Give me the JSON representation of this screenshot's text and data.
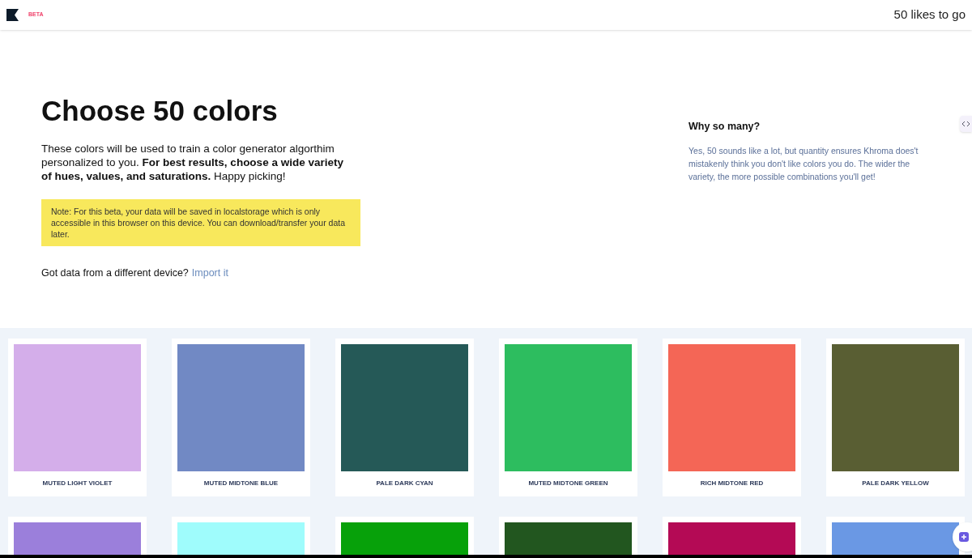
{
  "header": {
    "badge": "BETA",
    "progress": "50 likes to go"
  },
  "intro": {
    "title": "Choose 50 colors",
    "text": "These colors will be used to train a color generator algorthim personalized to you. **For best results, choose a wide variety of hues, values, and saturations.** Happy picking!",
    "note": "Note: For this beta, your data will be saved in localstorage which is only accessible in this browser on this device. You can download/transfer your data later.",
    "import_prompt": "Got data from a different device?",
    "import_link": "Import it"
  },
  "aside": {
    "title": "Why so many?",
    "text": "Yes, 50 sounds like a lot, but quantity ensures Khroma does't mistakenly think you don't like colors you do. The wider the variety, the more possible combinations you'll get!"
  },
  "swatches": [
    {
      "name": "MUTED LIGHT VIOLET",
      "color": "#d4aeea"
    },
    {
      "name": "MUTED MIDTONE BLUE",
      "color": "#7189c4"
    },
    {
      "name": "PALE DARK CYAN",
      "color": "#255957"
    },
    {
      "name": "MUTED MIDTONE GREEN",
      "color": "#2dbd5f"
    },
    {
      "name": "RICH MIDTONE RED",
      "color": "#f46656"
    },
    {
      "name": "PALE DARK YELLOW",
      "color": "#595e33"
    },
    {
      "color": "#9b7fdb"
    },
    {
      "color": "#9ffcfc"
    },
    {
      "color": "#07a10a"
    },
    {
      "color": "#22561f"
    },
    {
      "color": "#b40a55"
    },
    {
      "color": "#6a98e4"
    }
  ]
}
